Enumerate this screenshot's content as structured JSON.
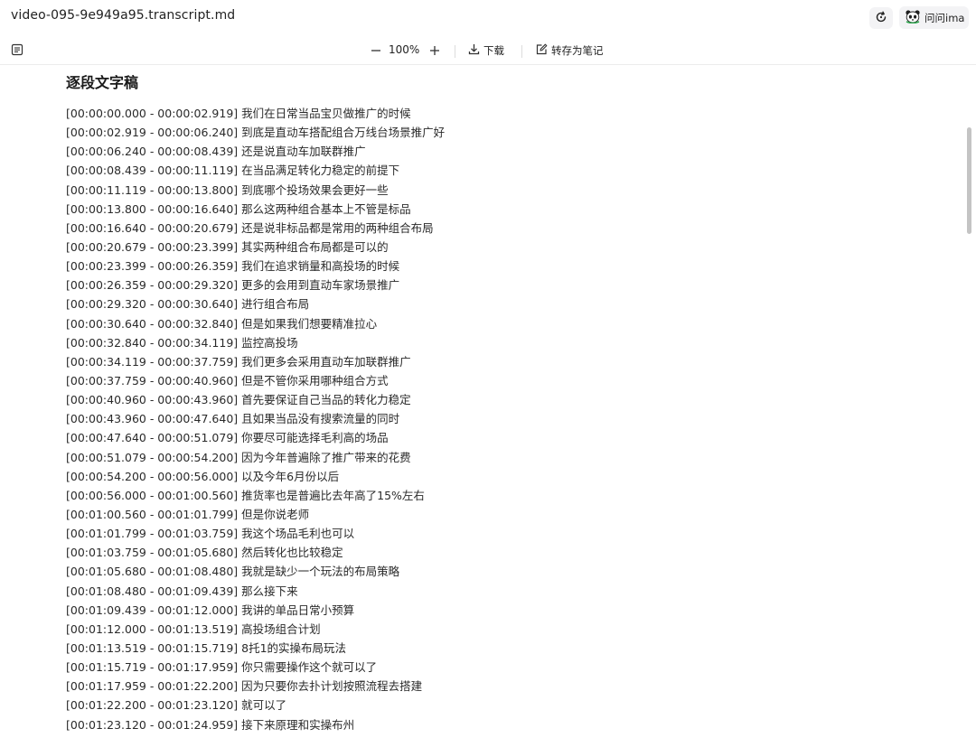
{
  "window": {
    "title": "video-095-9e949a95.transcript.md",
    "ima_label": "问问ima"
  },
  "toolbar": {
    "zoom": "100%",
    "download_label": "下载",
    "save_note_label": "转存为笔记"
  },
  "document": {
    "heading": "逐段文字稿",
    "lines": [
      "[00:00:00.000 - 00:00:02.919] 我们在日常当品宝贝做推广的时候",
      "[00:00:02.919 - 00:00:06.240] 到底是直动车搭配组合万线台场景推广好",
      "[00:00:06.240 - 00:00:08.439] 还是说直动车加联群推广",
      "[00:00:08.439 - 00:00:11.119] 在当品满足转化力稳定的前提下",
      "[00:00:11.119 - 00:00:13.800] 到底哪个投场效果会更好一些",
      "[00:00:13.800 - 00:00:16.640] 那么这两种组合基本上不管是标品",
      "[00:00:16.640 - 00:00:20.679] 还是说非标品都是常用的两种组合布局",
      "[00:00:20.679 - 00:00:23.399] 其实两种组合布局都是可以的",
      "[00:00:23.399 - 00:00:26.359] 我们在追求销量和高投场的时候",
      "[00:00:26.359 - 00:00:29.320] 更多的会用到直动车家场景推广",
      "[00:00:29.320 - 00:00:30.640] 进行组合布局",
      "[00:00:30.640 - 00:00:32.840] 但是如果我们想要精准拉心",
      "[00:00:32.840 - 00:00:34.119] 监控高投场",
      "[00:00:34.119 - 00:00:37.759] 我们更多会采用直动车加联群推广",
      "[00:00:37.759 - 00:00:40.960] 但是不管你采用哪种组合方式",
      "[00:00:40.960 - 00:00:43.960] 首先要保证自己当品的转化力稳定",
      "[00:00:43.960 - 00:00:47.640] 且如果当品没有搜索流量的同时",
      "[00:00:47.640 - 00:00:51.079] 你要尽可能选择毛利高的场品",
      "[00:00:51.079 - 00:00:54.200] 因为今年普遍除了推广带来的花费",
      "[00:00:54.200 - 00:00:56.000] 以及今年6月份以后",
      "[00:00:56.000 - 00:01:00.560] 推货率也是普遍比去年高了15%左右",
      "[00:01:00.560 - 00:01:01.799] 但是你说老师",
      "[00:01:01.799 - 00:01:03.759] 我这个场品毛利也可以",
      "[00:01:03.759 - 00:01:05.680] 然后转化也比较稳定",
      "[00:01:05.680 - 00:01:08.480] 我就是缺少一个玩法的布局策略",
      "[00:01:08.480 - 00:01:09.439] 那么接下来",
      "[00:01:09.439 - 00:01:12.000] 我讲的单品日常小预算",
      "[00:01:12.000 - 00:01:13.519] 高投场组合计划",
      "[00:01:13.519 - 00:01:15.719] 8托1的实操布局玩法",
      "[00:01:15.719 - 00:01:17.959] 你只需要操作这个就可以了",
      "[00:01:17.959 - 00:01:22.200] 因为只要你去扑计划按照流程去搭建",
      "[00:01:22.200 - 00:01:23.120] 就可以了",
      "[00:01:23.120 - 00:01:24.959] 接下来原理和实操布州"
    ]
  },
  "icons": {
    "toc": "outline-list-icon",
    "refresh": "refresh-icon",
    "ima": "panda-icon",
    "download": "download-icon",
    "save_note": "edit-note-icon"
  },
  "colors": {
    "text": "#2a2a2a",
    "button_bg": "#f3f3f5",
    "divider": "#ececec",
    "scrollbar": "#c4c4c4"
  }
}
